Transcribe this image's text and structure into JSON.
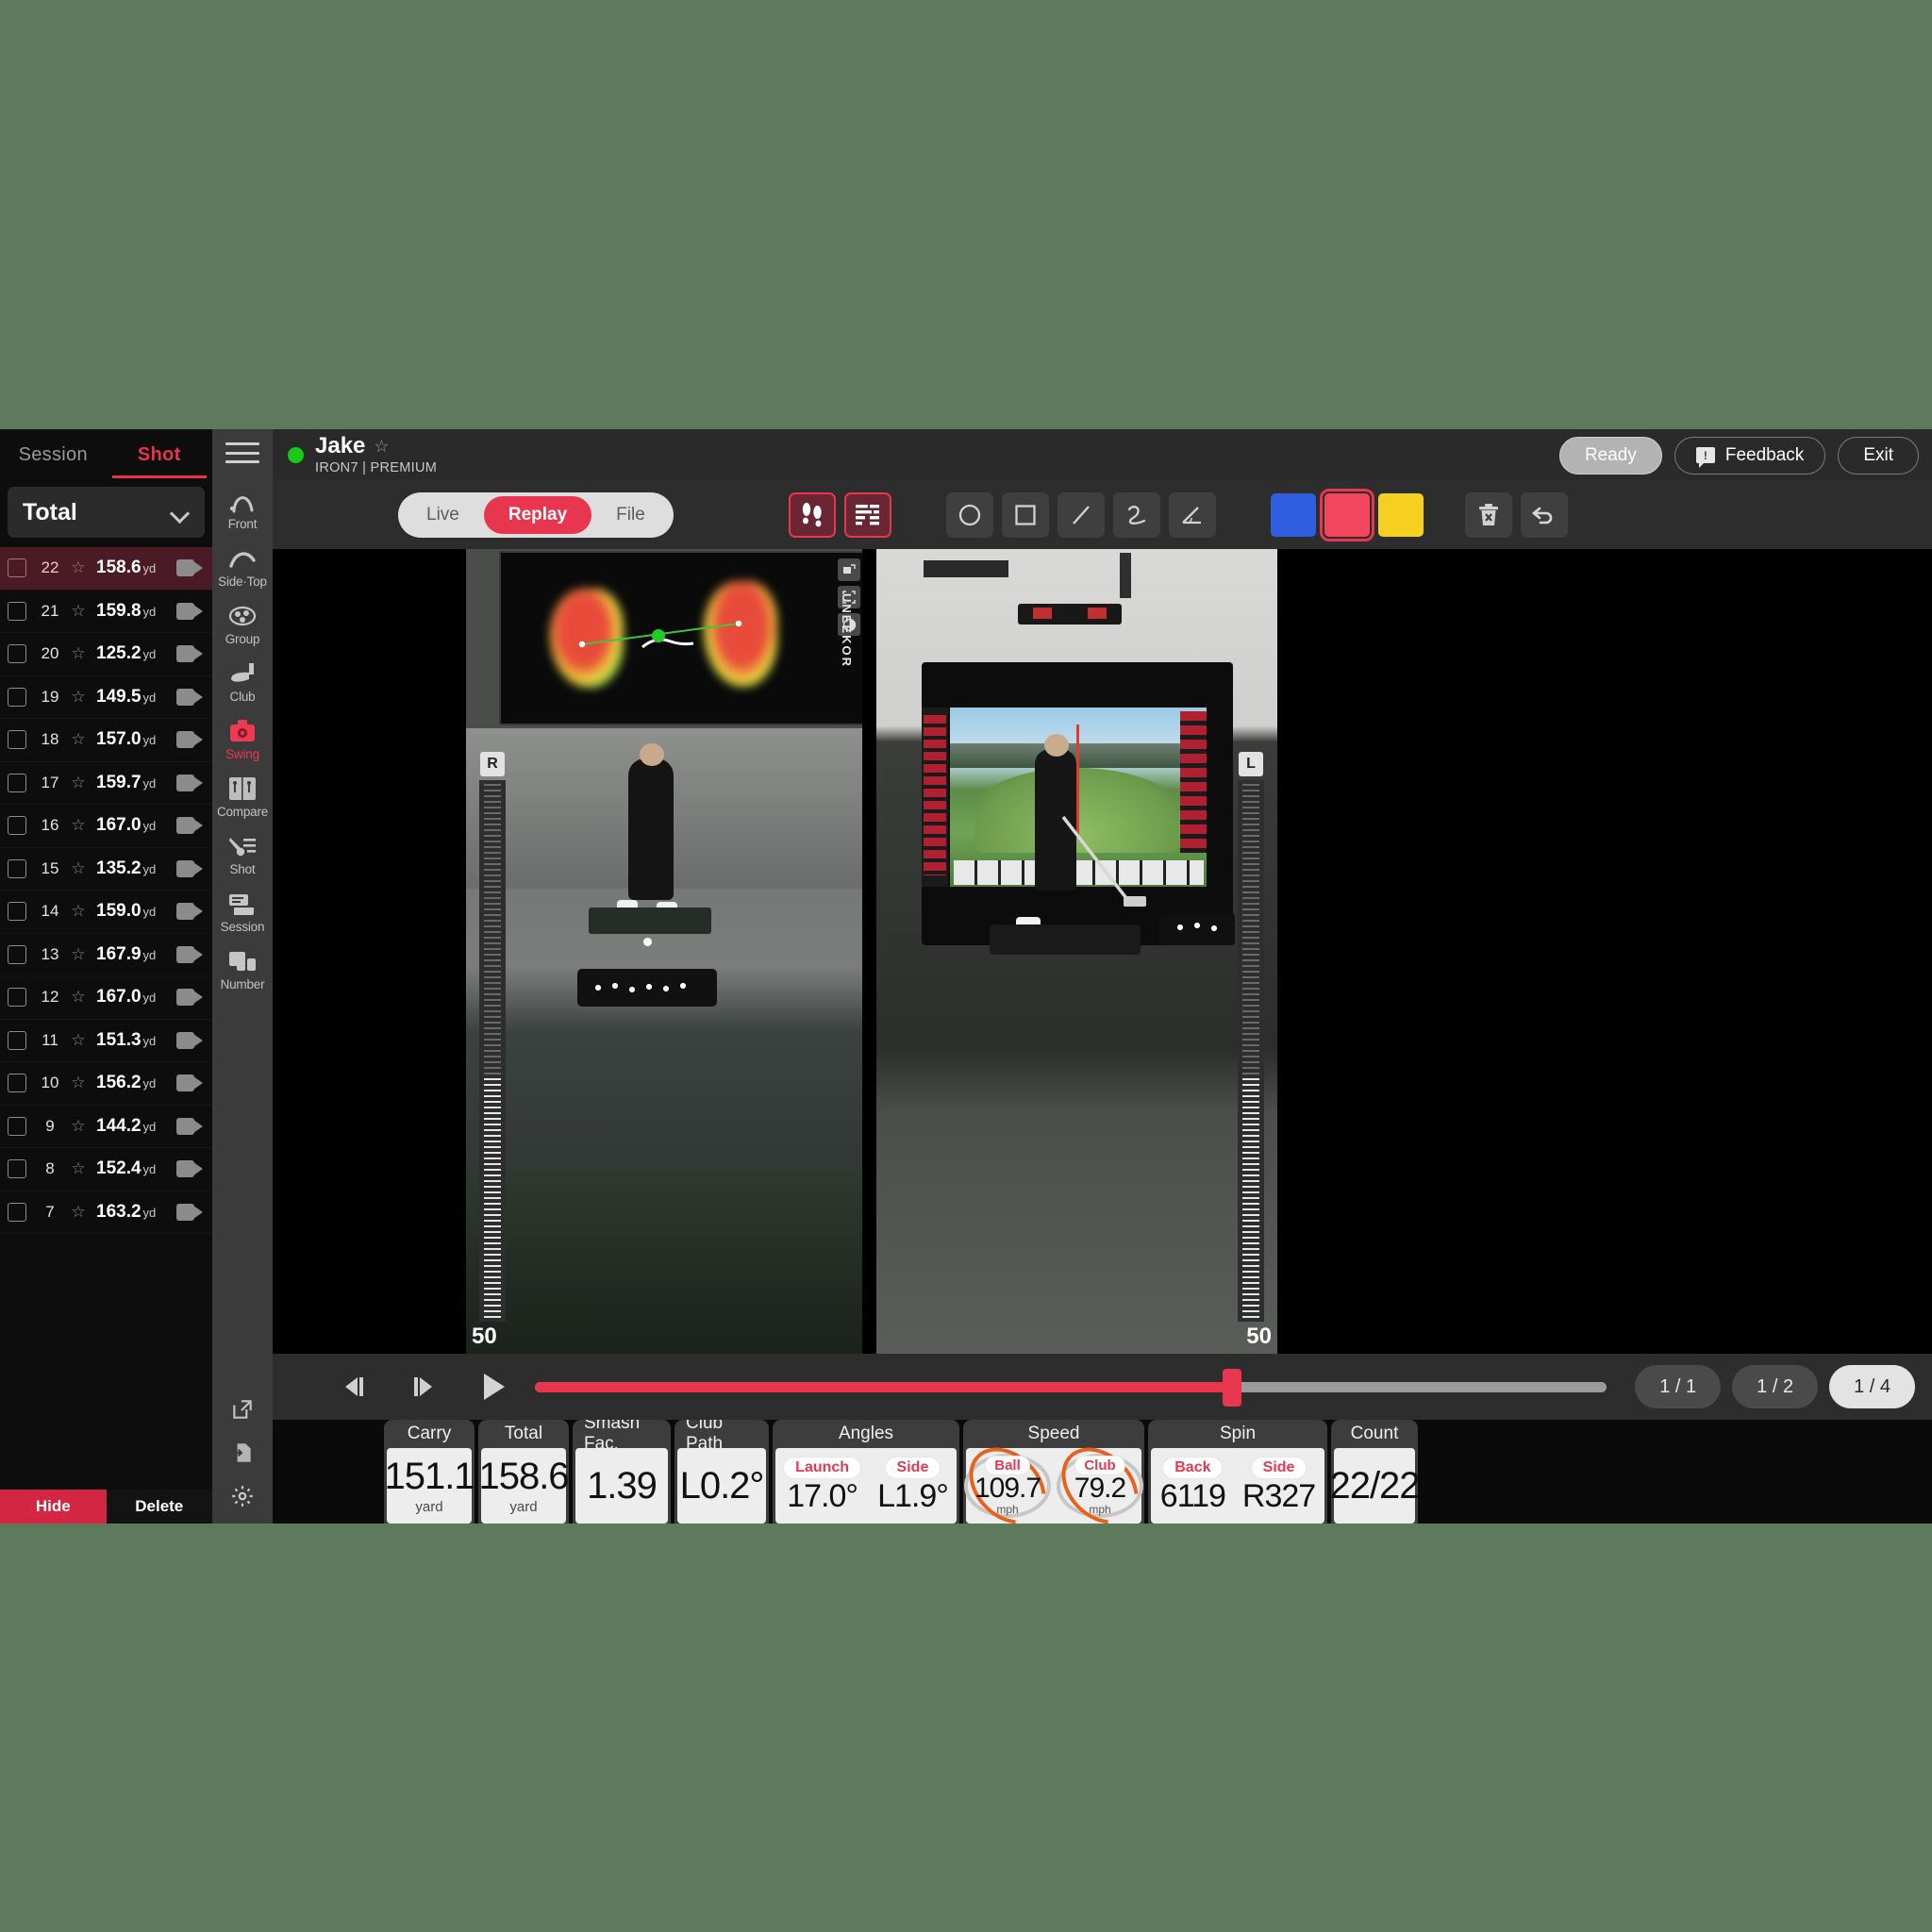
{
  "shotlist": {
    "tabs": [
      {
        "label": "Session",
        "active": false
      },
      {
        "label": "Shot",
        "active": true
      }
    ],
    "filter_label": "Total",
    "rows": [
      {
        "num": "22",
        "dist": "158.6",
        "unit": "yd",
        "selected": true
      },
      {
        "num": "21",
        "dist": "159.8",
        "unit": "yd",
        "selected": false
      },
      {
        "num": "20",
        "dist": "125.2",
        "unit": "yd",
        "selected": false
      },
      {
        "num": "19",
        "dist": "149.5",
        "unit": "yd",
        "selected": false
      },
      {
        "num": "18",
        "dist": "157.0",
        "unit": "yd",
        "selected": false
      },
      {
        "num": "17",
        "dist": "159.7",
        "unit": "yd",
        "selected": false
      },
      {
        "num": "16",
        "dist": "167.0",
        "unit": "yd",
        "selected": false
      },
      {
        "num": "15",
        "dist": "135.2",
        "unit": "yd",
        "selected": false
      },
      {
        "num": "14",
        "dist": "159.0",
        "unit": "yd",
        "selected": false
      },
      {
        "num": "13",
        "dist": "167.9",
        "unit": "yd",
        "selected": false
      },
      {
        "num": "12",
        "dist": "167.0",
        "unit": "yd",
        "selected": false
      },
      {
        "num": "11",
        "dist": "151.3",
        "unit": "yd",
        "selected": false
      },
      {
        "num": "10",
        "dist": "156.2",
        "unit": "yd",
        "selected": false
      },
      {
        "num": "9",
        "dist": "144.2",
        "unit": "yd",
        "selected": false
      },
      {
        "num": "8",
        "dist": "152.4",
        "unit": "yd",
        "selected": false
      },
      {
        "num": "7",
        "dist": "163.2",
        "unit": "yd",
        "selected": false
      }
    ],
    "hide_label": "Hide",
    "delete_label": "Delete"
  },
  "vnav": {
    "menu_icon": "hamburger-icon",
    "items": [
      {
        "label": "Front",
        "icon": "front-trajectory-icon",
        "active": false
      },
      {
        "label": "Side·Top",
        "icon": "side-top-trajectory-icon",
        "active": false
      },
      {
        "label": "Group",
        "icon": "dispersion-group-icon",
        "active": false
      },
      {
        "label": "Club",
        "icon": "club-head-icon",
        "active": false
      },
      {
        "label": "Swing",
        "icon": "swing-camera-icon",
        "active": true
      },
      {
        "label": "Compare",
        "icon": "compare-icon",
        "active": false
      },
      {
        "label": "Shot",
        "icon": "shot-list-icon",
        "active": false
      },
      {
        "label": "Session",
        "icon": "session-icon",
        "active": false
      },
      {
        "label": "Number",
        "icon": "number-icon",
        "active": false
      }
    ],
    "bottom_icons": [
      "external-link-icon",
      "export-file-icon",
      "gear-icon"
    ]
  },
  "header": {
    "status_indicator": "online-dot",
    "player_name": "Jake",
    "favorite_icon": "star-outline-icon",
    "subtitle": "IRON7 | PREMIUM",
    "ready_label": "Ready",
    "feedback_label": "Feedback",
    "feedback_icon": "feedback-icon",
    "exit_label": "Exit"
  },
  "toolbar": {
    "modes": [
      {
        "label": "Live",
        "active": false
      },
      {
        "label": "Replay",
        "active": true
      },
      {
        "label": "File",
        "active": false
      }
    ],
    "overlay_toggles": [
      {
        "icon": "footprints-icon",
        "active": true
      },
      {
        "icon": "pressure-bars-icon",
        "active": true
      }
    ],
    "draw_tools": [
      {
        "icon": "circle-tool-icon",
        "active": false
      },
      {
        "icon": "square-tool-icon",
        "active": false
      },
      {
        "icon": "line-tool-icon",
        "active": false
      },
      {
        "icon": "freehand-tool-icon",
        "active": false
      },
      {
        "icon": "angle-tool-icon",
        "active": false
      }
    ],
    "colors": [
      {
        "name": "blue-swatch",
        "hex": "#2f5fe0",
        "selected": false
      },
      {
        "name": "red-swatch",
        "hex": "#f2465e",
        "selected": true
      },
      {
        "name": "yellow-swatch",
        "hex": "#f5d020",
        "selected": false
      }
    ],
    "actions": [
      {
        "icon": "delete-all-icon"
      },
      {
        "icon": "undo-icon"
      }
    ]
  },
  "stage": {
    "left_scale": {
      "badge": "R",
      "value": "50"
    },
    "right_scale": {
      "badge": "L",
      "value": "50"
    },
    "heatmap_brand": "UNEEKOR",
    "heatmap_tools": [
      "picture-in-picture-icon",
      "fullscreen-icon",
      "contrast-icon"
    ]
  },
  "playback": {
    "controls": [
      {
        "icon": "step-back-icon"
      },
      {
        "icon": "step-forward-icon"
      },
      {
        "icon": "play-icon"
      }
    ],
    "progress_percent": 65,
    "speeds": [
      {
        "label": "1 / 1",
        "active": false
      },
      {
        "label": "1 / 2",
        "active": false
      },
      {
        "label": "1 / 4",
        "active": true
      }
    ]
  },
  "stats": [
    {
      "kind": "single",
      "title": "Carry",
      "value": "151.1",
      "unit": "yard",
      "width": 96
    },
    {
      "kind": "single",
      "title": "Total",
      "value": "158.6",
      "unit": "yard",
      "width": 96
    },
    {
      "kind": "single",
      "title": "Smash Fac.",
      "value": "1.39",
      "unit": "",
      "width": 104
    },
    {
      "kind": "single",
      "title": "Club Path",
      "value": "L0.2°",
      "unit": "",
      "width": 100
    },
    {
      "kind": "dual",
      "title": "Angles",
      "items": [
        {
          "tag": "Launch",
          "value": "17.0°"
        },
        {
          "tag": "Side",
          "value": "L1.9°"
        }
      ],
      "width": 198
    },
    {
      "kind": "gauge",
      "title": "Speed",
      "items": [
        {
          "tag": "Ball",
          "value": "109.7",
          "unit": "mph",
          "pct": 72
        },
        {
          "tag": "Club",
          "value": "79.2",
          "unit": "mph",
          "pct": 80
        }
      ],
      "width": 192
    },
    {
      "kind": "dual",
      "title": "Spin",
      "items": [
        {
          "tag": "Back",
          "value": "6119"
        },
        {
          "tag": "Side",
          "value": "R327"
        }
      ],
      "width": 190
    },
    {
      "kind": "single",
      "title": "Count",
      "value": "22/22",
      "unit": "",
      "width": 92
    }
  ]
}
